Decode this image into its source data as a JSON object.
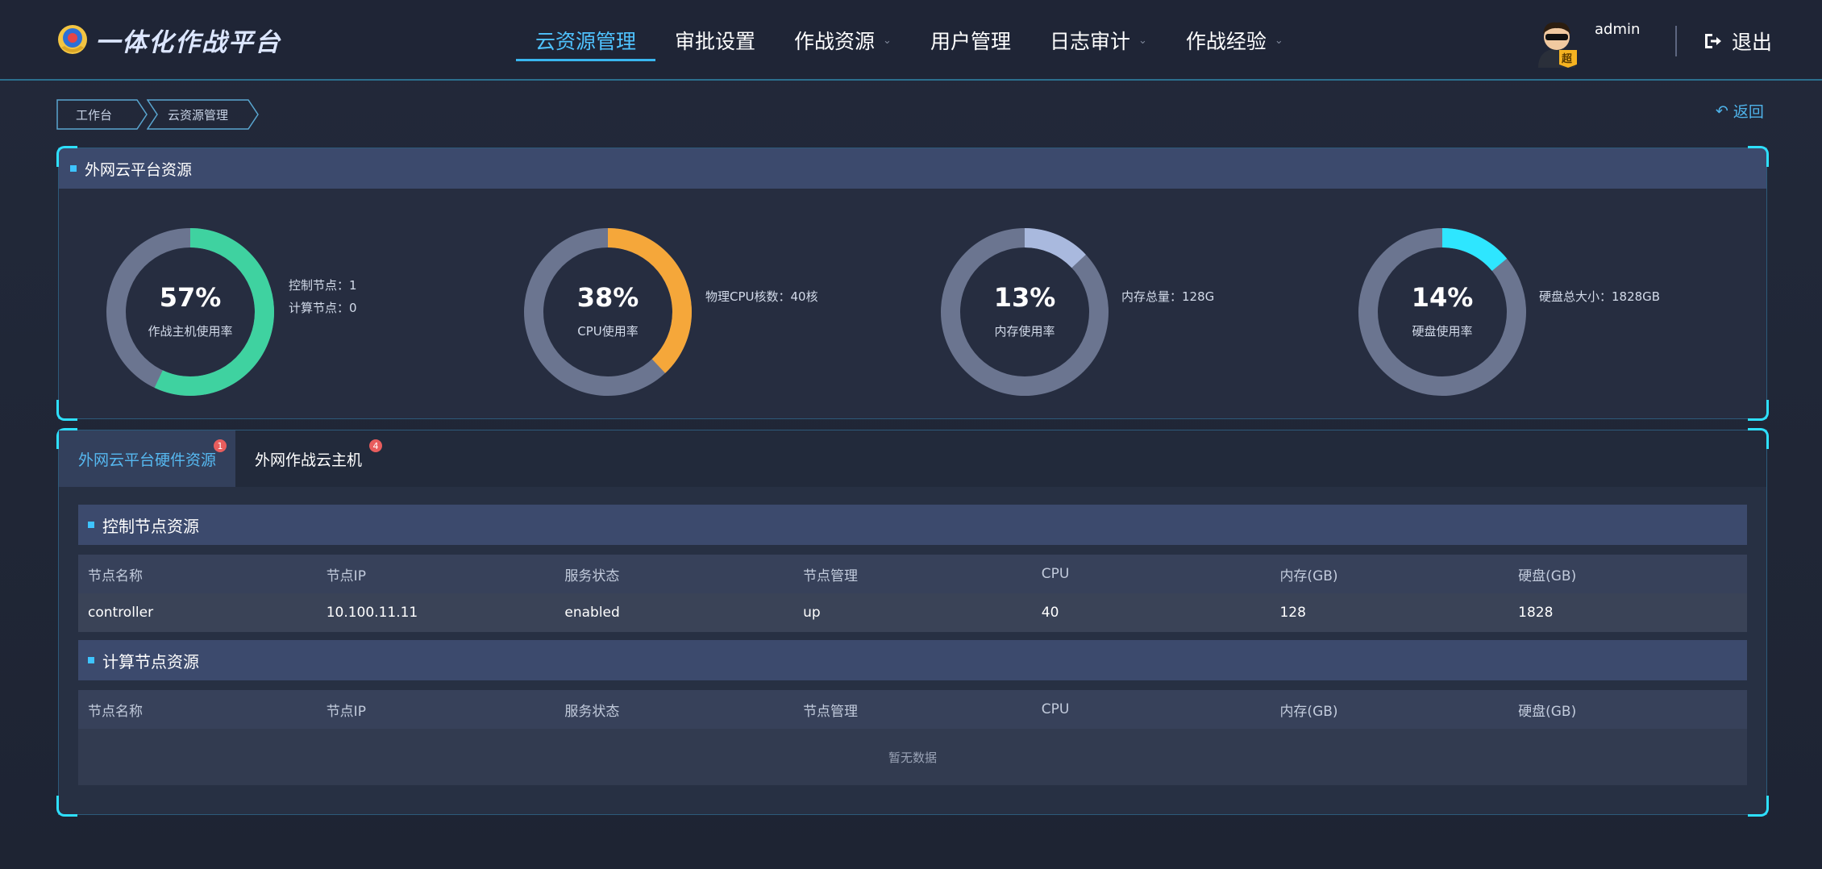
{
  "app": {
    "title": "一体化作战平台",
    "logo_icon": "police-emblem-icon"
  },
  "nav": {
    "items": [
      {
        "label": "云资源管理",
        "active": true,
        "has_dropdown": false
      },
      {
        "label": "审批设置",
        "active": false,
        "has_dropdown": false
      },
      {
        "label": "作战资源",
        "active": false,
        "has_dropdown": true
      },
      {
        "label": "用户管理",
        "active": false,
        "has_dropdown": false
      },
      {
        "label": "日志审计",
        "active": false,
        "has_dropdown": true
      },
      {
        "label": "作战经验",
        "active": false,
        "has_dropdown": true
      }
    ]
  },
  "user": {
    "name": "admin",
    "badge": "超",
    "logout_label": "退出"
  },
  "breadcrumb": [
    "工作台",
    "云资源管理"
  ],
  "back_label": "返回",
  "overview": {
    "title": "外网云平台资源",
    "gauges": [
      {
        "value_text": "57%",
        "value": 0.57,
        "label": "作战主机使用率",
        "color": "#3fd2a0",
        "info": [
          "控制节点：1",
          "计算节点：0"
        ]
      },
      {
        "value_text": "38%",
        "value": 0.38,
        "label": "CPU使用率",
        "color": "#f5a73a",
        "info": [
          "物理CPU核数：40核"
        ]
      },
      {
        "value_text": "13%",
        "value": 0.13,
        "label": "内存使用率",
        "color": "#a9b9de",
        "info": [
          "内存总量：128G"
        ]
      },
      {
        "value_text": "14%",
        "value": 0.14,
        "label": "硬盘使用率",
        "color": "#2ee6ff",
        "info": [
          "硬盘总大小：1828GB"
        ]
      }
    ],
    "track_color": "#6b7590"
  },
  "tabs": [
    {
      "label": "外网云平台硬件资源",
      "badge": "1",
      "active": true
    },
    {
      "label": "外网作战云主机",
      "badge": "4",
      "active": false
    }
  ],
  "control_nodes": {
    "title": "控制节点资源",
    "columns": [
      "节点名称",
      "节点IP",
      "服务状态",
      "节点管理",
      "CPU",
      "内存(GB)",
      "硬盘(GB)"
    ],
    "rows": [
      [
        "controller",
        "10.100.11.11",
        "enabled",
        "up",
        "40",
        "128",
        "1828"
      ]
    ]
  },
  "compute_nodes": {
    "title": "计算节点资源",
    "columns": [
      "节点名称",
      "节点IP",
      "服务状态",
      "节点管理",
      "CPU",
      "内存(GB)",
      "硬盘(GB)"
    ],
    "empty_text": "暂无数据"
  }
}
